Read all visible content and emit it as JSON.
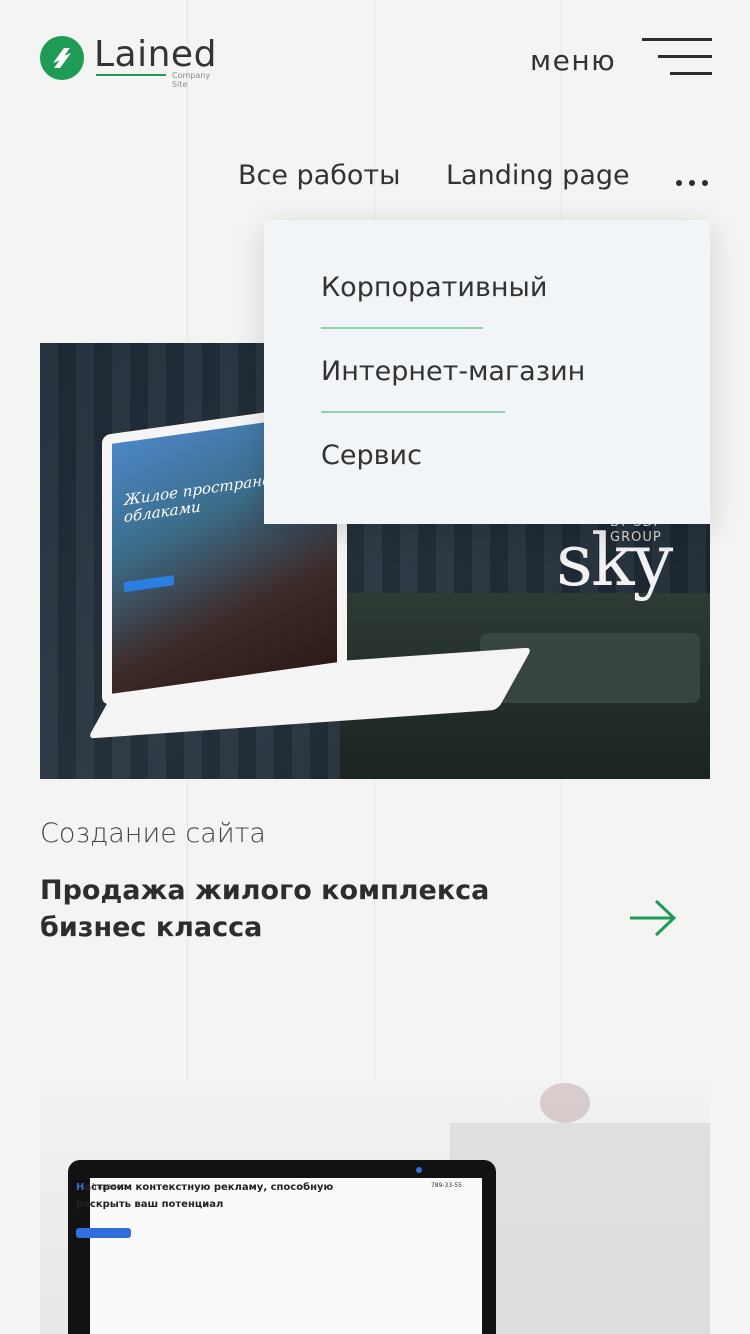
{
  "header": {
    "logo_name": "Lained",
    "logo_tagline": "Company Site",
    "menu_label": "меню"
  },
  "filters": {
    "items": [
      {
        "label": "Все работы"
      },
      {
        "label": "Landing page"
      }
    ],
    "more_icon": "ellipsis-icon"
  },
  "dropdown": {
    "items": [
      {
        "label": "Корпоративный"
      },
      {
        "label": "Интернет-магазин"
      },
      {
        "label": "Сервис"
      }
    ],
    "divider_color": "#8fd1b0"
  },
  "cards": [
    {
      "image": {
        "screen_heading": "Жилое пространство под облаками",
        "brand": "sky",
        "brand_sub": "BY SDI GROUP"
      },
      "category": "Создание сайта",
      "title": "Продажа жилого комплекса бизнес класса",
      "arrow_icon": "arrow-right-icon"
    },
    {
      "image": {
        "screen_brand": "Impacco",
        "screen_phone": "789-33-55",
        "screen_heading_accent": "Н",
        "screen_heading": "астроим контекстную рекламу, способную раскрыть ваш потенциал"
      }
    }
  ],
  "colors": {
    "accent": "#1f9b55",
    "page_bg": "#f4f4f3",
    "text": "#2d2d2d"
  }
}
